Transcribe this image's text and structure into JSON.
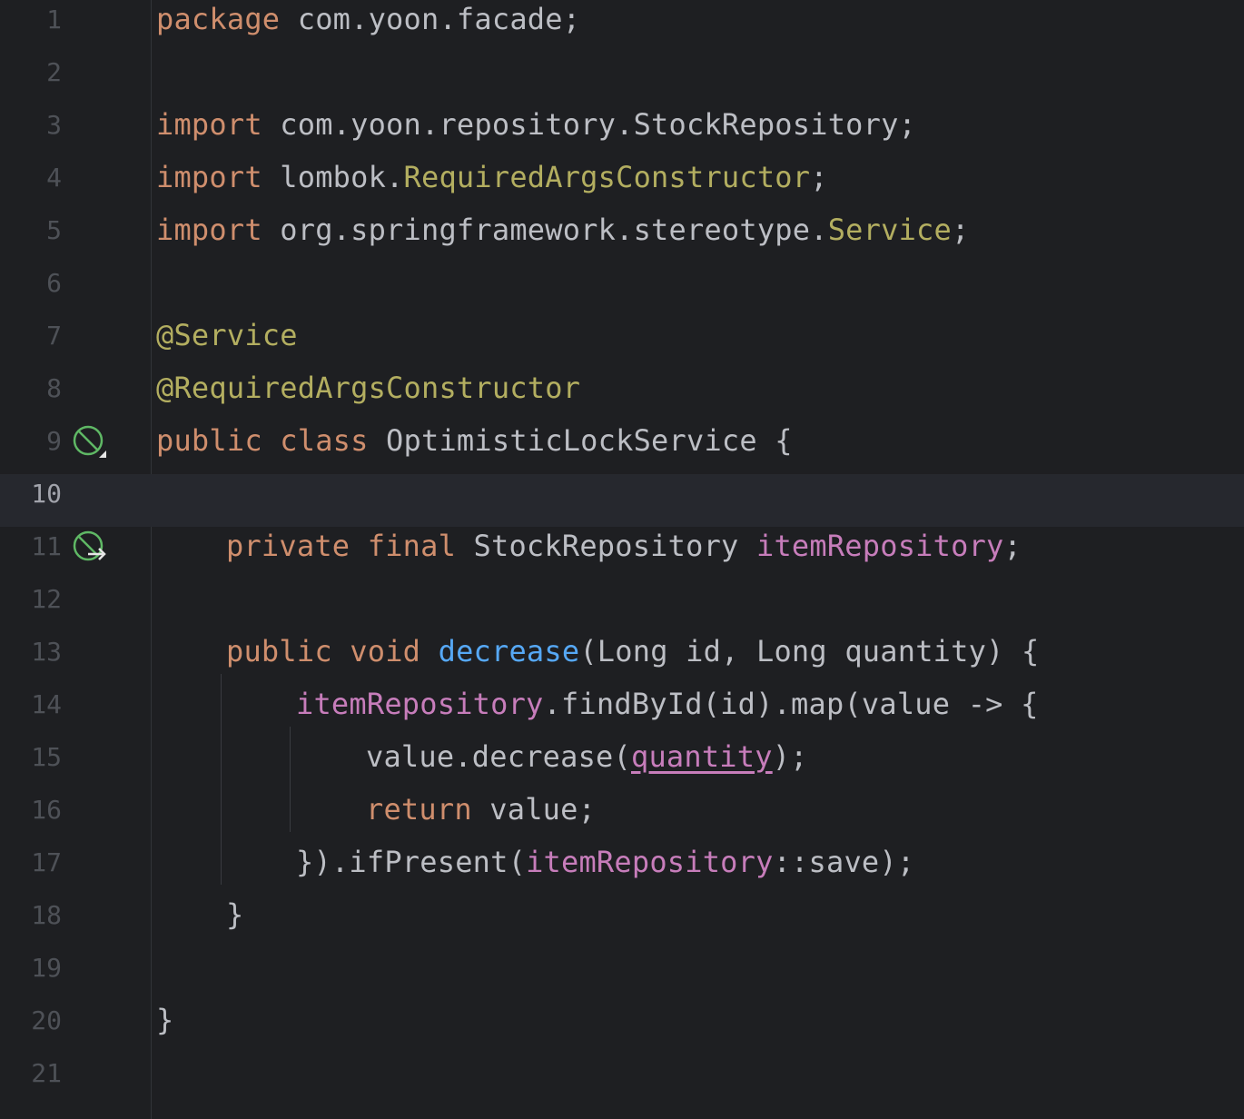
{
  "editor": {
    "current_line": 10,
    "lines": [
      {
        "n": "1",
        "indent": 0,
        "tokens": [
          {
            "t": "package",
            "c": "kw"
          },
          {
            "t": " com.yoon.facade;",
            "c": "cls"
          }
        ]
      },
      {
        "n": "2",
        "indent": 0,
        "tokens": []
      },
      {
        "n": "3",
        "indent": 0,
        "tokens": [
          {
            "t": "import",
            "c": "kw"
          },
          {
            "t": " com.yoon.repository.StockRepository;",
            "c": "cls"
          }
        ]
      },
      {
        "n": "4",
        "indent": 0,
        "tokens": [
          {
            "t": "import",
            "c": "kw"
          },
          {
            "t": " lombok.",
            "c": "cls"
          },
          {
            "t": "RequiredArgsConstructor",
            "c": "lib"
          },
          {
            "t": ";",
            "c": "cls"
          }
        ]
      },
      {
        "n": "5",
        "indent": 0,
        "tokens": [
          {
            "t": "import",
            "c": "kw"
          },
          {
            "t": " org.springframework.stereotype.",
            "c": "cls"
          },
          {
            "t": "Service",
            "c": "lib"
          },
          {
            "t": ";",
            "c": "cls"
          }
        ]
      },
      {
        "n": "6",
        "indent": 0,
        "tokens": []
      },
      {
        "n": "7",
        "indent": 0,
        "tokens": [
          {
            "t": "@Service",
            "c": "ann"
          }
        ]
      },
      {
        "n": "8",
        "indent": 0,
        "tokens": [
          {
            "t": "@RequiredArgsConstructor",
            "c": "ann"
          }
        ]
      },
      {
        "n": "9",
        "indent": 0,
        "icon": "spring-bean-icon",
        "tokens": [
          {
            "t": "public",
            "c": "kw"
          },
          {
            "t": " ",
            "c": "cls"
          },
          {
            "t": "class",
            "c": "kw"
          },
          {
            "t": " OptimisticLockService {",
            "c": "cls"
          }
        ]
      },
      {
        "n": "10",
        "indent": 0,
        "tokens": []
      },
      {
        "n": "11",
        "indent": 1,
        "icon": "spring-autowired-icon",
        "tokens": [
          {
            "t": "private",
            "c": "kw"
          },
          {
            "t": " ",
            "c": "cls"
          },
          {
            "t": "final",
            "c": "kw"
          },
          {
            "t": " StockRepository ",
            "c": "cls"
          },
          {
            "t": "itemRepository",
            "c": "field"
          },
          {
            "t": ";",
            "c": "cls"
          }
        ]
      },
      {
        "n": "12",
        "indent": 0,
        "tokens": []
      },
      {
        "n": "13",
        "indent": 1,
        "tokens": [
          {
            "t": "public",
            "c": "kw"
          },
          {
            "t": " ",
            "c": "cls"
          },
          {
            "t": "void",
            "c": "kw"
          },
          {
            "t": " ",
            "c": "cls"
          },
          {
            "t": "decrease",
            "c": "method"
          },
          {
            "t": "(Long id, Long quantity) {",
            "c": "cls"
          }
        ]
      },
      {
        "n": "14",
        "indent": 2,
        "tokens": [
          {
            "t": "itemRepository",
            "c": "field"
          },
          {
            "t": ".findById(id).map(value -> {",
            "c": "cls"
          }
        ]
      },
      {
        "n": "15",
        "indent": 3,
        "tokens": [
          {
            "t": "value.decrease(",
            "c": "cls"
          },
          {
            "t": "quantity",
            "c": "param-u"
          },
          {
            "t": ");",
            "c": "cls"
          }
        ]
      },
      {
        "n": "16",
        "indent": 3,
        "tokens": [
          {
            "t": "return",
            "c": "kw"
          },
          {
            "t": " value;",
            "c": "cls"
          }
        ]
      },
      {
        "n": "17",
        "indent": 2,
        "tokens": [
          {
            "t": "}).ifPresent(",
            "c": "cls"
          },
          {
            "t": "itemRepository",
            "c": "field"
          },
          {
            "t": "::save);",
            "c": "cls"
          }
        ]
      },
      {
        "n": "18",
        "indent": 1,
        "tokens": [
          {
            "t": "}",
            "c": "cls"
          }
        ]
      },
      {
        "n": "19",
        "indent": 0,
        "tokens": []
      },
      {
        "n": "20",
        "indent": 0,
        "tokens": [
          {
            "t": "}",
            "c": "cls"
          }
        ]
      },
      {
        "n": "21",
        "indent": 0,
        "tokens": []
      }
    ]
  },
  "colors": {
    "background": "#1e1f22",
    "current_line": "#26282e",
    "keyword": "#cf8e6d",
    "annotation": "#b3ae60",
    "field": "#c77dbb",
    "method": "#56a8f5",
    "text": "#bcbec4",
    "line_number": "#4e5157",
    "gutter_icon": "#5fb865"
  }
}
